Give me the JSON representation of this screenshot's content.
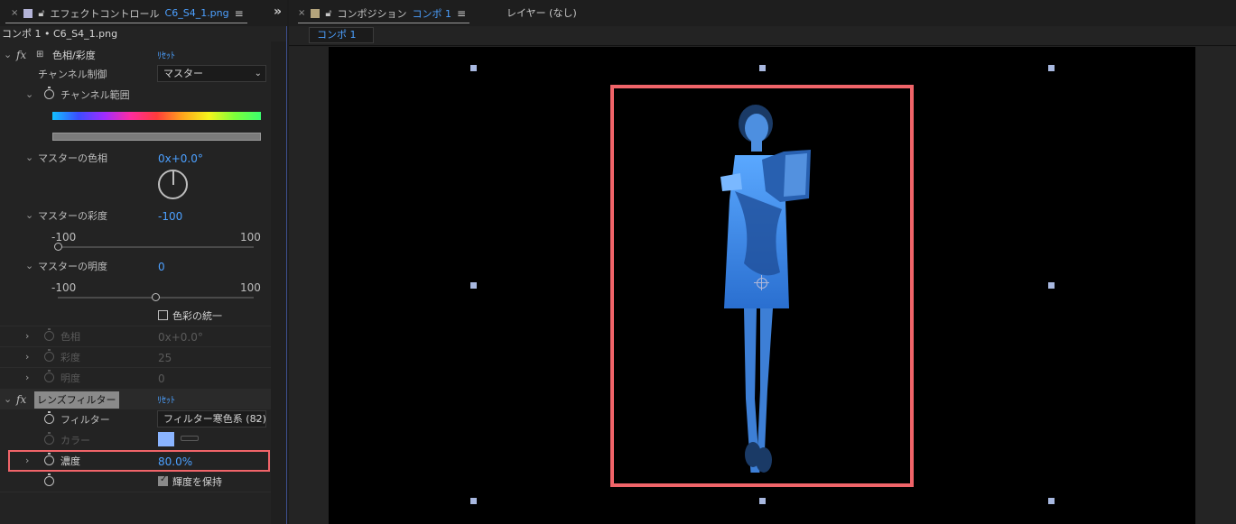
{
  "left_panel": {
    "tab": {
      "prefix": "エフェクトコントロール",
      "file": "C6_S4_1.png"
    },
    "layer_title": "コンポ 1 • C6_S4_1.png",
    "hue_sat": {
      "name": "色相/彩度",
      "reset": "ﾘｾｯﾄ",
      "channel_control_label": "チャンネル制御",
      "channel_control_value": "マスター",
      "channel_range_label": "チャンネル範囲",
      "master_hue_label": "マスターの色相",
      "master_hue_value": "0x+0.0°",
      "master_sat_label": "マスターの彩度",
      "master_sat_value": "-100",
      "master_sat_min": "-100",
      "master_sat_max": "100",
      "master_light_label": "マスターの明度",
      "master_light_value": "0",
      "master_light_min": "-100",
      "master_light_max": "100",
      "colorize_label": "色彩の統一",
      "hue_label": "色相",
      "hue_value": "0x+0.0°",
      "saturation_label": "彩度",
      "saturation_value": "25",
      "lightness_label": "明度",
      "lightness_value": "0"
    },
    "lens_filter": {
      "name": "レンズフィルター",
      "reset": "ﾘｾｯﾄ",
      "filter_label": "フィルター",
      "filter_value": "フィルター寒色系 (82)",
      "color_label": "カラー",
      "density_label": "濃度",
      "density_value": "80.0%",
      "preserve_label": "輝度を保持"
    }
  },
  "right_panel": {
    "tab": {
      "prefix": "コンポジション",
      "name": "コンポ 1"
    },
    "layer_label": "レイヤー (なし)",
    "comp_chip": "コンポ 1"
  },
  "values": {
    "master_sat_slider": 0.0,
    "master_light_slider": 0.5
  },
  "colors": {
    "accent": "#4ca0ff",
    "highlight": "#f06469",
    "filter_color": "#8ab4ff"
  }
}
